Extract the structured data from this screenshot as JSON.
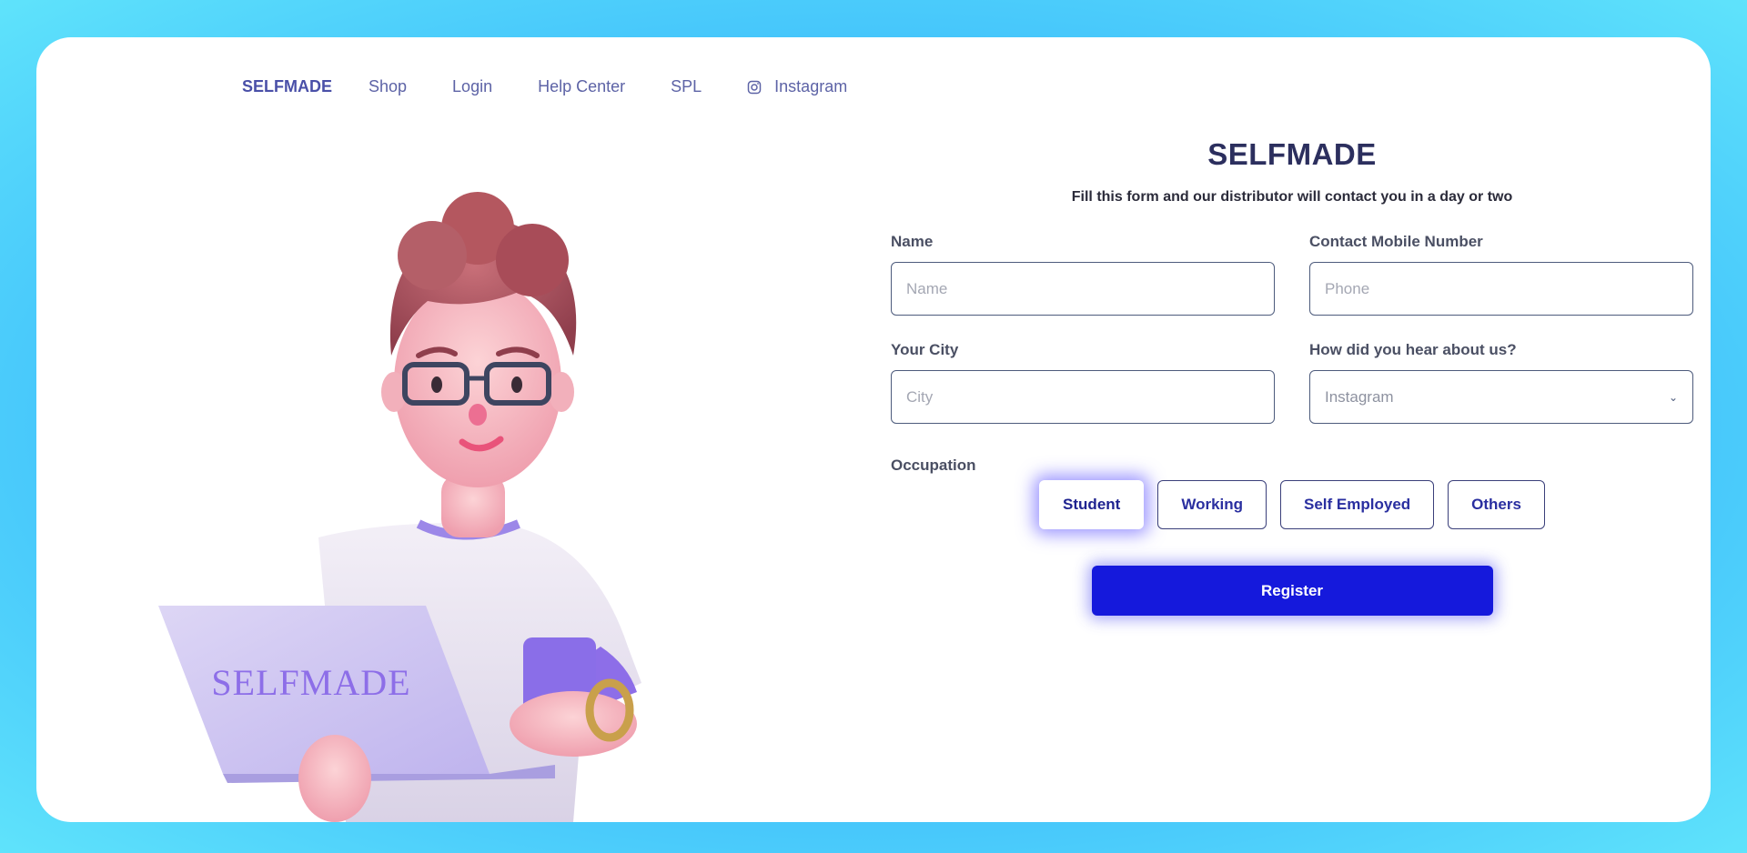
{
  "nav": {
    "brand": "SELFMADE",
    "links": [
      "Shop",
      "Login",
      "Help Center",
      "SPL"
    ],
    "instagram": "Instagram"
  },
  "illustration": {
    "laptop_logo": "SELFMADE"
  },
  "form": {
    "title": "SELFMADE",
    "subtitle": "Fill this form and our distributor will contact you in a day or two",
    "name": {
      "label": "Name",
      "placeholder": "Name"
    },
    "phone": {
      "label": "Contact Mobile Number",
      "placeholder": "Phone"
    },
    "city": {
      "label": "Your City",
      "placeholder": "City"
    },
    "source": {
      "label": "How did you hear about us?",
      "value": "Instagram"
    },
    "occupation": {
      "label": "Occupation",
      "options": [
        "Student",
        "Working",
        "Self Employed",
        "Others"
      ],
      "selected": "Student"
    },
    "register_label": "Register"
  },
  "colors": {
    "accent": "#1519dc",
    "nav_text": "#5d63a6",
    "title": "#2c2f5e"
  }
}
